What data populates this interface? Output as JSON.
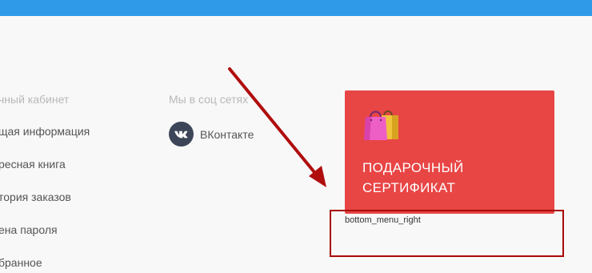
{
  "footer": {
    "account": {
      "title": "чный кабинет",
      "items": [
        "щая информация",
        "ресная книга",
        "тория заказов",
        "ена пароля",
        "бранное"
      ]
    },
    "social": {
      "title": "Мы в соц сетях",
      "vk_label": "ВКонтакте",
      "vk_icon": "vk-icon"
    },
    "gift_card": {
      "line1": "ПОДАРОЧНЫЙ",
      "line2": "СЕРТИФИКАТ",
      "color": "#e84545",
      "icon": "shopping-bags-icon"
    },
    "placeholder": "bottom_menu_right"
  },
  "colors": {
    "header": "#2f9ae8",
    "annotation": "#a80a0a"
  }
}
